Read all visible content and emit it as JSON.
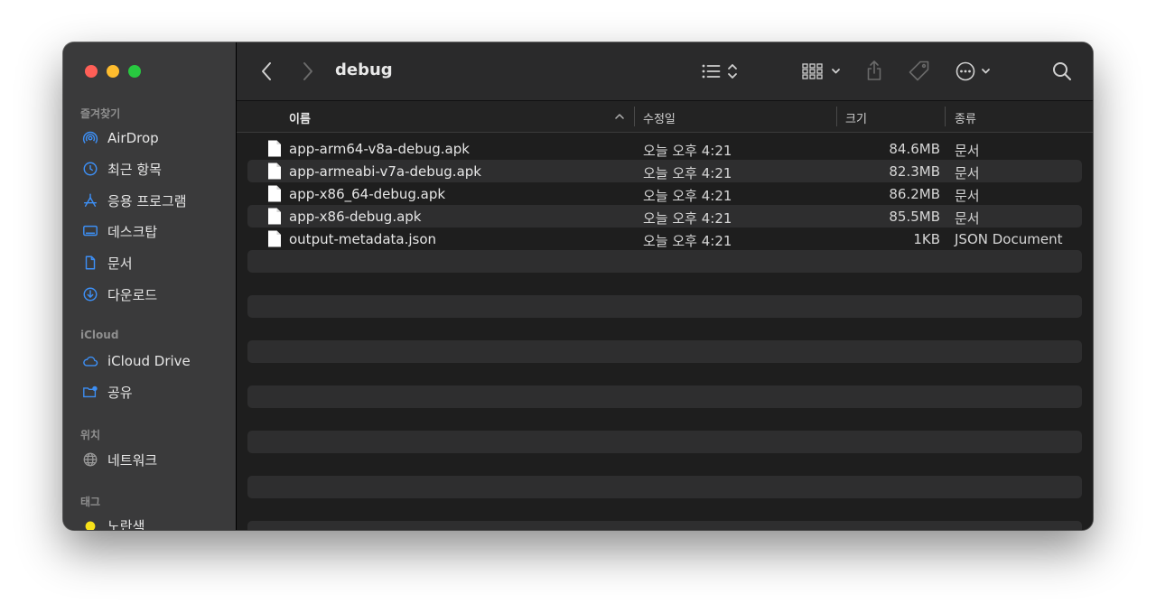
{
  "toolbar": {
    "title": "debug"
  },
  "sidebar": {
    "sections": {
      "favorites": "즐겨찾기",
      "icloud": "iCloud",
      "locations": "위치",
      "tags": "태그"
    },
    "items": [
      {
        "label": "AirDrop",
        "icon": "airdrop-icon"
      },
      {
        "label": "최근 항목",
        "icon": "clock-icon"
      },
      {
        "label": "응용 프로그램",
        "icon": "applications-icon"
      },
      {
        "label": "데스크탑",
        "icon": "desktop-icon"
      },
      {
        "label": "문서",
        "icon": "document-icon"
      },
      {
        "label": "다운로드",
        "icon": "download-icon"
      },
      {
        "label": "iCloud Drive",
        "icon": "cloud-icon"
      },
      {
        "label": "공유",
        "icon": "shared-folder-icon"
      },
      {
        "label": "네트워크",
        "icon": "globe-icon"
      },
      {
        "label": "노란색",
        "icon": "yellow-tag-icon",
        "color": "#f7e11a"
      }
    ]
  },
  "columns": {
    "name": "이름",
    "date": "수정일",
    "size": "크기",
    "kind": "종류"
  },
  "files": [
    {
      "name": "app-arm64-v8a-debug.apk",
      "date": "오늘 오후 4:21",
      "size": "84.6MB",
      "kind": "문서"
    },
    {
      "name": "app-armeabi-v7a-debug.apk",
      "date": "오늘 오후 4:21",
      "size": "82.3MB",
      "kind": "문서"
    },
    {
      "name": "app-x86_64-debug.apk",
      "date": "오늘 오후 4:21",
      "size": "86.2MB",
      "kind": "문서"
    },
    {
      "name": "app-x86-debug.apk",
      "date": "오늘 오후 4:21",
      "size": "85.5MB",
      "kind": "문서"
    },
    {
      "name": "output-metadata.json",
      "date": "오늘 오후 4:21",
      "size": "1KB",
      "kind": "JSON Document"
    }
  ]
}
